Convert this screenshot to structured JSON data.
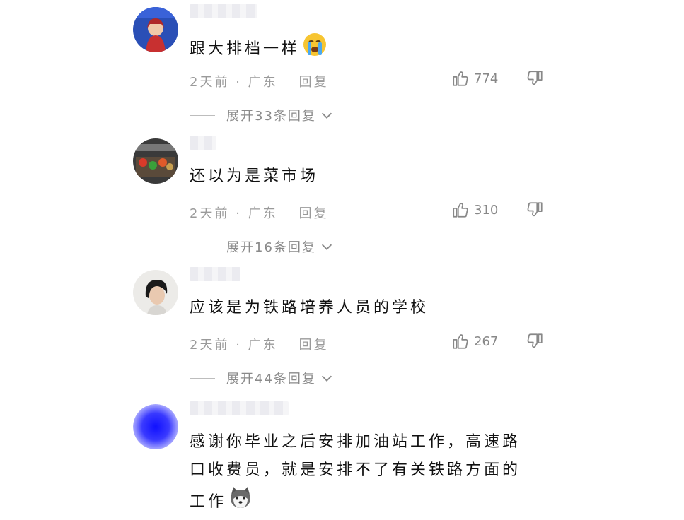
{
  "comments": [
    {
      "avatar": "person-avatar",
      "text": "跟大排档一样",
      "emoji": "crying-face-emoji",
      "time": "2天前",
      "location": "广东",
      "reply_label": "回复",
      "likes": "774",
      "expand_label": "展开33条回复"
    },
    {
      "avatar": "vegetables-avatar",
      "text": "还以为是菜市场",
      "time": "2天前",
      "location": "广东",
      "reply_label": "回复",
      "likes": "310",
      "expand_label": "展开16条回复"
    },
    {
      "avatar": "woman-avatar",
      "text": "应该是为铁路培养人员的学校",
      "time": "2天前",
      "location": "广东",
      "reply_label": "回复",
      "likes": "267",
      "expand_label": "展开44条回复"
    },
    {
      "avatar": "blue-gradient-avatar",
      "text": "感谢你毕业之后安排加油站工作，高速路口收费员，就是安排不了有关铁路方面的工作",
      "emoji": "husky-dog-emoji"
    }
  ],
  "separator": "·",
  "colors": {
    "meta": "#9a9a9a",
    "avatar_blue": "#1a1aff"
  }
}
